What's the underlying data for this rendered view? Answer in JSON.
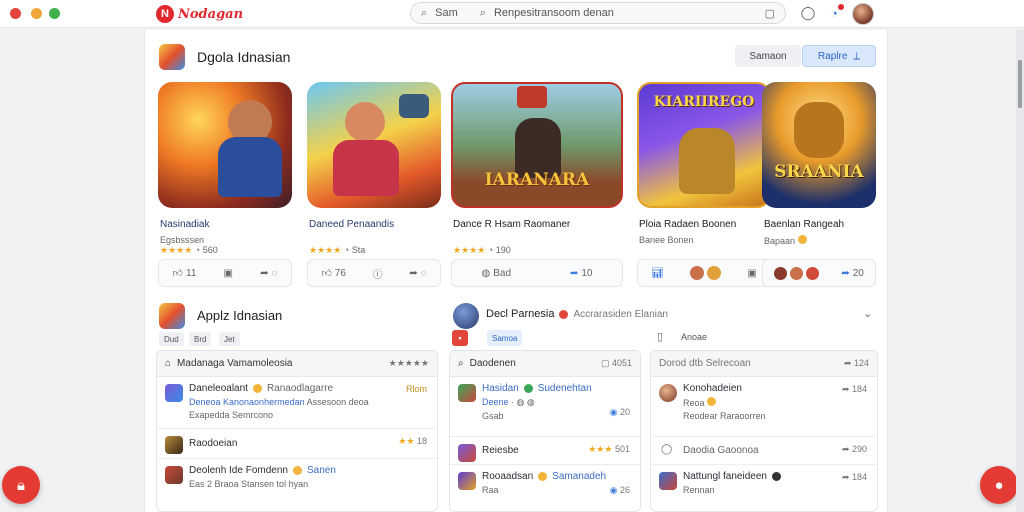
{
  "topbar": {
    "brand": "Nodagan",
    "search_scope": "Sam",
    "search_text": "Renpesitransoom denan",
    "avatar": "user-avatar"
  },
  "featured": {
    "title": "Dgola Idnasian",
    "btn_secondary": "Samaon",
    "btn_primary": "Raplre",
    "cards": [
      {
        "title": "Nasinadiak",
        "meta": "Egsbsssen",
        "rating": "★★★★",
        "rating_count": "560",
        "a1": "11",
        "thumb_text": ""
      },
      {
        "title": "Daneed Penaandis",
        "meta": "",
        "rating": "★★★★",
        "rating_count": "Sta",
        "a1": "76",
        "thumb_text": ""
      },
      {
        "title": "Dance R Hsam Raomaner",
        "meta": "",
        "rating": "★★★★",
        "rating_count": "190",
        "a1": "Bad",
        "a2": "10",
        "thumb_text": "IARANARA"
      },
      {
        "title": "Ploia Radaen Boonen",
        "meta": "Banee Bonen",
        "rating": "",
        "rating_count": "",
        "thumb_text": "KIARIIREGO"
      },
      {
        "title": "Baenlan Rangeah",
        "meta": "Bapaan",
        "rating": "",
        "rating_count": "",
        "a2": "20",
        "thumb_text": "SRAANIA"
      }
    ]
  },
  "apps": {
    "title": "Applz Idnasian",
    "tags": [
      "Dud",
      "Brd",
      "Jet"
    ],
    "list1": {
      "header": "Madanaga Vamamoleosia",
      "header_rating": "★★★★★",
      "rows": [
        {
          "title": "Daneleoalant",
          "sub": "Ranaodlagarre",
          "value": "Rlom"
        },
        {
          "title": "Deneoa Kanonaonhermedan",
          "sub": "Exapedda Semrcono",
          "value": "Assesoon deoa"
        },
        {
          "title": "Raodoeian",
          "sub": "",
          "rating": "★★",
          "value": "18"
        },
        {
          "title": "Deolenh Ide Fomdenn",
          "sub": "Eas 2 Braoa Stansen tol hyan",
          "value": "Sanen"
        }
      ]
    }
  },
  "middle": {
    "title": "Decl Parnesia",
    "subtitle": "Accrarasiden Elanian",
    "tab": "Samoa",
    "list": {
      "header": "Daodenen",
      "header_right": "4051",
      "rows": [
        {
          "title": "Hasidan",
          "title2": "Sudenehtan",
          "sub": "Deene",
          "value": "20"
        },
        {
          "title": "Reiesbe",
          "rating": "★★★",
          "value": "501"
        },
        {
          "title": "Rooaadsan",
          "title2": "Samanadeh",
          "sub": "Raa",
          "value": "26"
        }
      ],
      "row1_sub2": "Gsab"
    }
  },
  "right": {
    "tab_label": "Anoae",
    "list": {
      "header": "Dorod dtb Selrecoan",
      "header_right": "124",
      "rows": [
        {
          "title": "Konohadeien",
          "sub": "Reoa",
          "value": "184",
          "sub2": "Reodear Raraoorren"
        },
        {
          "title": "Daodia Gaoonoa",
          "value": "290"
        },
        {
          "title": "Nattungl faneideen",
          "value": "184",
          "sub": "Rennan"
        }
      ]
    }
  }
}
